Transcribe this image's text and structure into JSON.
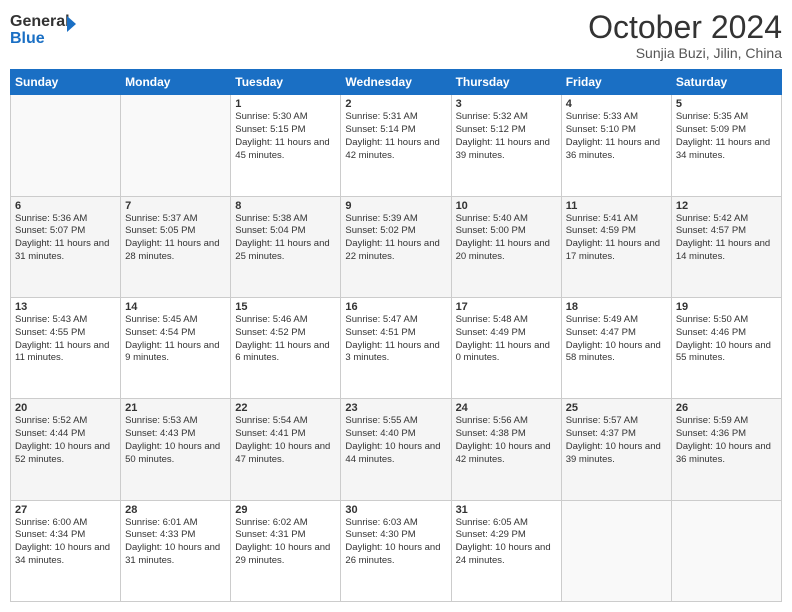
{
  "logo": {
    "line1": "General",
    "line2": "Blue"
  },
  "title": "October 2024",
  "subtitle": "Sunjia Buzi, Jilin, China",
  "days_of_week": [
    "Sunday",
    "Monday",
    "Tuesday",
    "Wednesday",
    "Thursday",
    "Friday",
    "Saturday"
  ],
  "weeks": [
    [
      {
        "day": "",
        "sunrise": "",
        "sunset": "",
        "daylight": ""
      },
      {
        "day": "",
        "sunrise": "",
        "sunset": "",
        "daylight": ""
      },
      {
        "day": "1",
        "sunrise": "Sunrise: 5:30 AM",
        "sunset": "Sunset: 5:15 PM",
        "daylight": "Daylight: 11 hours and 45 minutes."
      },
      {
        "day": "2",
        "sunrise": "Sunrise: 5:31 AM",
        "sunset": "Sunset: 5:14 PM",
        "daylight": "Daylight: 11 hours and 42 minutes."
      },
      {
        "day": "3",
        "sunrise": "Sunrise: 5:32 AM",
        "sunset": "Sunset: 5:12 PM",
        "daylight": "Daylight: 11 hours and 39 minutes."
      },
      {
        "day": "4",
        "sunrise": "Sunrise: 5:33 AM",
        "sunset": "Sunset: 5:10 PM",
        "daylight": "Daylight: 11 hours and 36 minutes."
      },
      {
        "day": "5",
        "sunrise": "Sunrise: 5:35 AM",
        "sunset": "Sunset: 5:09 PM",
        "daylight": "Daylight: 11 hours and 34 minutes."
      }
    ],
    [
      {
        "day": "6",
        "sunrise": "Sunrise: 5:36 AM",
        "sunset": "Sunset: 5:07 PM",
        "daylight": "Daylight: 11 hours and 31 minutes."
      },
      {
        "day": "7",
        "sunrise": "Sunrise: 5:37 AM",
        "sunset": "Sunset: 5:05 PM",
        "daylight": "Daylight: 11 hours and 28 minutes."
      },
      {
        "day": "8",
        "sunrise": "Sunrise: 5:38 AM",
        "sunset": "Sunset: 5:04 PM",
        "daylight": "Daylight: 11 hours and 25 minutes."
      },
      {
        "day": "9",
        "sunrise": "Sunrise: 5:39 AM",
        "sunset": "Sunset: 5:02 PM",
        "daylight": "Daylight: 11 hours and 22 minutes."
      },
      {
        "day": "10",
        "sunrise": "Sunrise: 5:40 AM",
        "sunset": "Sunset: 5:00 PM",
        "daylight": "Daylight: 11 hours and 20 minutes."
      },
      {
        "day": "11",
        "sunrise": "Sunrise: 5:41 AM",
        "sunset": "Sunset: 4:59 PM",
        "daylight": "Daylight: 11 hours and 17 minutes."
      },
      {
        "day": "12",
        "sunrise": "Sunrise: 5:42 AM",
        "sunset": "Sunset: 4:57 PM",
        "daylight": "Daylight: 11 hours and 14 minutes."
      }
    ],
    [
      {
        "day": "13",
        "sunrise": "Sunrise: 5:43 AM",
        "sunset": "Sunset: 4:55 PM",
        "daylight": "Daylight: 11 hours and 11 minutes."
      },
      {
        "day": "14",
        "sunrise": "Sunrise: 5:45 AM",
        "sunset": "Sunset: 4:54 PM",
        "daylight": "Daylight: 11 hours and 9 minutes."
      },
      {
        "day": "15",
        "sunrise": "Sunrise: 5:46 AM",
        "sunset": "Sunset: 4:52 PM",
        "daylight": "Daylight: 11 hours and 6 minutes."
      },
      {
        "day": "16",
        "sunrise": "Sunrise: 5:47 AM",
        "sunset": "Sunset: 4:51 PM",
        "daylight": "Daylight: 11 hours and 3 minutes."
      },
      {
        "day": "17",
        "sunrise": "Sunrise: 5:48 AM",
        "sunset": "Sunset: 4:49 PM",
        "daylight": "Daylight: 11 hours and 0 minutes."
      },
      {
        "day": "18",
        "sunrise": "Sunrise: 5:49 AM",
        "sunset": "Sunset: 4:47 PM",
        "daylight": "Daylight: 10 hours and 58 minutes."
      },
      {
        "day": "19",
        "sunrise": "Sunrise: 5:50 AM",
        "sunset": "Sunset: 4:46 PM",
        "daylight": "Daylight: 10 hours and 55 minutes."
      }
    ],
    [
      {
        "day": "20",
        "sunrise": "Sunrise: 5:52 AM",
        "sunset": "Sunset: 4:44 PM",
        "daylight": "Daylight: 10 hours and 52 minutes."
      },
      {
        "day": "21",
        "sunrise": "Sunrise: 5:53 AM",
        "sunset": "Sunset: 4:43 PM",
        "daylight": "Daylight: 10 hours and 50 minutes."
      },
      {
        "day": "22",
        "sunrise": "Sunrise: 5:54 AM",
        "sunset": "Sunset: 4:41 PM",
        "daylight": "Daylight: 10 hours and 47 minutes."
      },
      {
        "day": "23",
        "sunrise": "Sunrise: 5:55 AM",
        "sunset": "Sunset: 4:40 PM",
        "daylight": "Daylight: 10 hours and 44 minutes."
      },
      {
        "day": "24",
        "sunrise": "Sunrise: 5:56 AM",
        "sunset": "Sunset: 4:38 PM",
        "daylight": "Daylight: 10 hours and 42 minutes."
      },
      {
        "day": "25",
        "sunrise": "Sunrise: 5:57 AM",
        "sunset": "Sunset: 4:37 PM",
        "daylight": "Daylight: 10 hours and 39 minutes."
      },
      {
        "day": "26",
        "sunrise": "Sunrise: 5:59 AM",
        "sunset": "Sunset: 4:36 PM",
        "daylight": "Daylight: 10 hours and 36 minutes."
      }
    ],
    [
      {
        "day": "27",
        "sunrise": "Sunrise: 6:00 AM",
        "sunset": "Sunset: 4:34 PM",
        "daylight": "Daylight: 10 hours and 34 minutes."
      },
      {
        "day": "28",
        "sunrise": "Sunrise: 6:01 AM",
        "sunset": "Sunset: 4:33 PM",
        "daylight": "Daylight: 10 hours and 31 minutes."
      },
      {
        "day": "29",
        "sunrise": "Sunrise: 6:02 AM",
        "sunset": "Sunset: 4:31 PM",
        "daylight": "Daylight: 10 hours and 29 minutes."
      },
      {
        "day": "30",
        "sunrise": "Sunrise: 6:03 AM",
        "sunset": "Sunset: 4:30 PM",
        "daylight": "Daylight: 10 hours and 26 minutes."
      },
      {
        "day": "31",
        "sunrise": "Sunrise: 6:05 AM",
        "sunset": "Sunset: 4:29 PM",
        "daylight": "Daylight: 10 hours and 24 minutes."
      },
      {
        "day": "",
        "sunrise": "",
        "sunset": "",
        "daylight": ""
      },
      {
        "day": "",
        "sunrise": "",
        "sunset": "",
        "daylight": ""
      }
    ]
  ]
}
